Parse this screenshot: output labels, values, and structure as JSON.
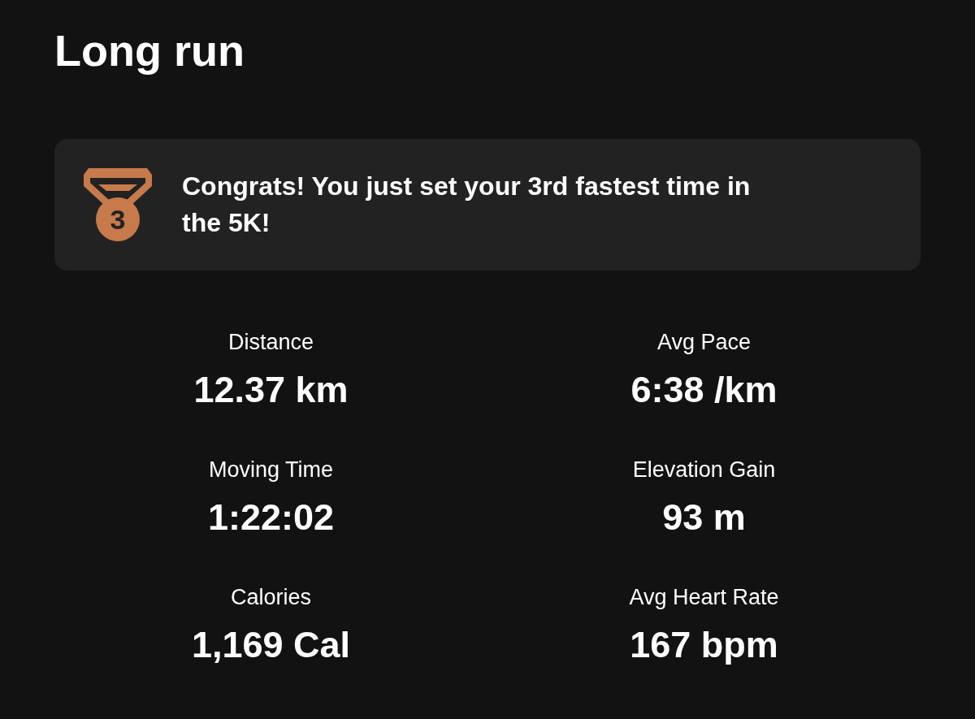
{
  "title": "Long run",
  "achievement": {
    "rank": "3",
    "message": "Congrats! You just set your 3rd fastest time in the 5K!"
  },
  "stats": [
    {
      "label": "Distance",
      "value": "12.37 km"
    },
    {
      "label": "Avg Pace",
      "value": "6:38 /km"
    },
    {
      "label": "Moving Time",
      "value": "1:22:02"
    },
    {
      "label": "Elevation Gain",
      "value": "93 m"
    },
    {
      "label": "Calories",
      "value": "1,169 Cal"
    },
    {
      "label": "Avg Heart Rate",
      "value": "167 bpm"
    }
  ]
}
